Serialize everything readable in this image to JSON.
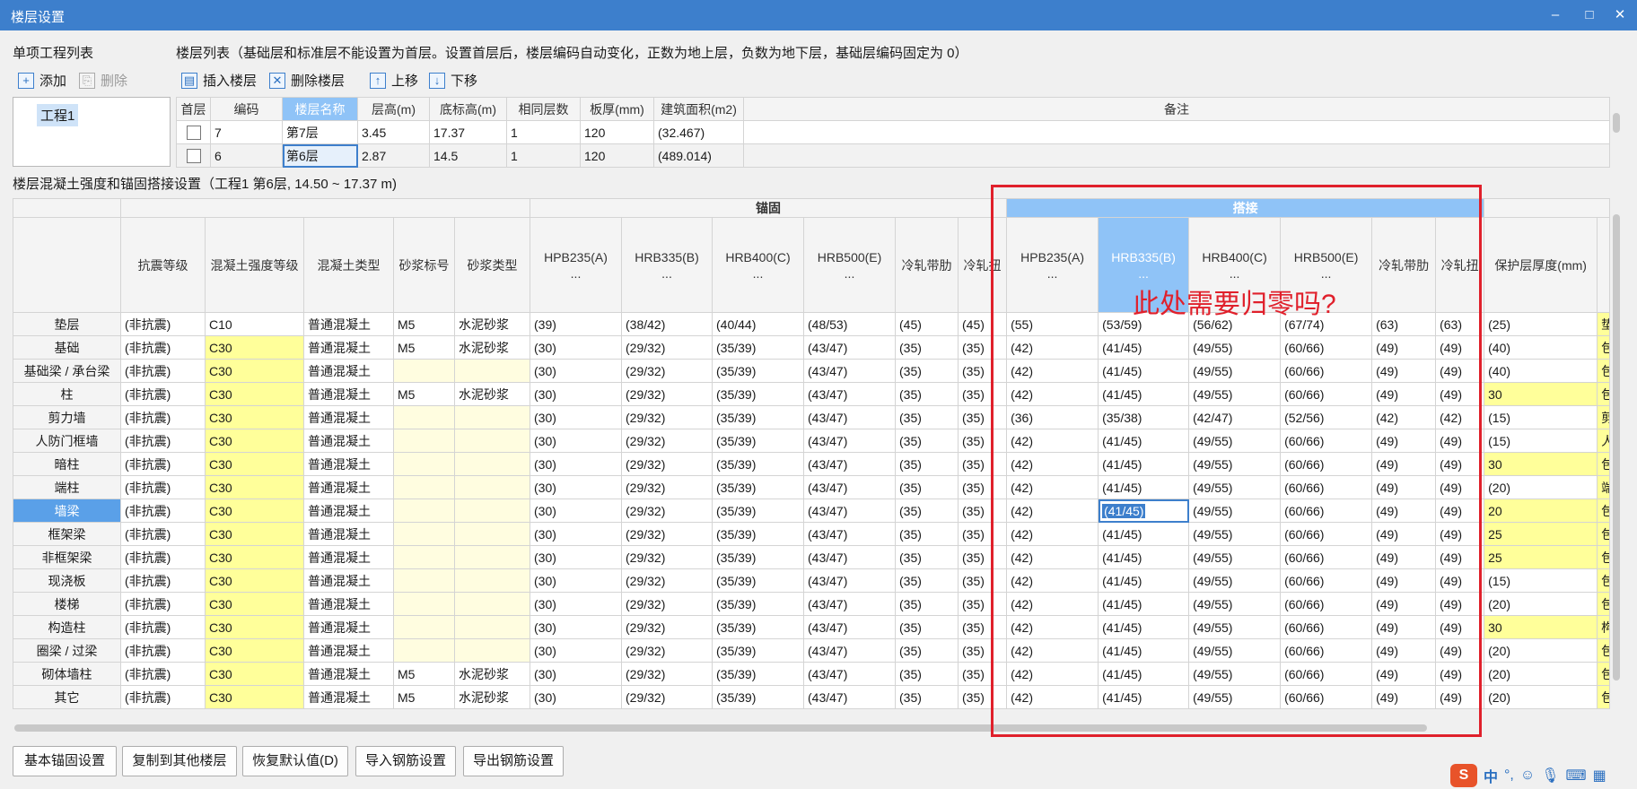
{
  "window": {
    "title": "楼层设置",
    "min": "–",
    "max": "□",
    "close": "✕"
  },
  "left": {
    "title": "单项工程列表",
    "add": "添加",
    "delete": "删除",
    "project": "工程1"
  },
  "floor": {
    "title": "楼层列表（基础层和标准层不能设置为首层。设置首层后，楼层编码自动变化，正数为地上层，负数为地下层，基础层编码固定为 0）",
    "insert": "插入楼层",
    "remove": "删除楼层",
    "up": "上移",
    "down": "下移",
    "headers": [
      "首层",
      "编码",
      "楼层名称",
      "层高(m)",
      "底标高(m)",
      "相同层数",
      "板厚(mm)",
      "建筑面积(m2)",
      "备注"
    ],
    "rows": [
      [
        "7",
        "第7层",
        "3.45",
        "17.37",
        "1",
        "120",
        "(32.467)"
      ],
      [
        "6",
        "第6层",
        "2.87",
        "14.5",
        "1",
        "120",
        "(489.014)"
      ]
    ]
  },
  "grid": {
    "title": "楼层混凝土强度和锚固搭接设置（工程1 第6层, 14.50 ~ 17.37 m)",
    "group_anchor": "锚固",
    "group_lap": "搭接",
    "headers": [
      "抗震等级",
      "混凝土强度等级",
      "混凝土类型",
      "砂浆标号",
      "砂浆类型"
    ],
    "sub_anchor": [
      "HPB235(A)",
      "HRB335(B)",
      "HRB400(C)",
      "HRB500(E)",
      "冷轧带肋",
      "冷轧扭"
    ],
    "sub_lap": [
      "HPB235(A)",
      "HRB335(B)",
      "HRB400(C)",
      "HRB500(E)",
      "冷轧带肋",
      "冷轧扭"
    ],
    "ellipsis": "...",
    "cover": "保护层厚度(mm)",
    "rows": [
      {
        "n": "垫层",
        "k": "(非抗震)",
        "c": "C10",
        "t": "普通混凝土",
        "m": "M5",
        "mt": "水泥砂浆",
        "a": [
          "(39)",
          "(38/42)",
          "(40/44)",
          "(48/53)",
          "(45)",
          "(45)"
        ],
        "l": [
          "(55)",
          "(53/59)",
          "(56/62)",
          "(67/74)",
          "(63)",
          "(63)"
        ],
        "p": "(25)",
        "r": "垫"
      },
      {
        "n": "基础",
        "k": "(非抗震)",
        "c": "C30",
        "t": "普通混凝土",
        "m": "M5",
        "mt": "水泥砂浆",
        "a": [
          "(30)",
          "(29/32)",
          "(35/39)",
          "(43/47)",
          "(35)",
          "(35)"
        ],
        "l": [
          "(42)",
          "(41/45)",
          "(49/55)",
          "(60/66)",
          "(49)",
          "(49)"
        ],
        "p": "(40)",
        "r": "包"
      },
      {
        "n": "基础梁 / 承台梁",
        "k": "(非抗震)",
        "c": "C30",
        "t": "普通混凝土",
        "m": "",
        "mt": "",
        "a": [
          "(30)",
          "(29/32)",
          "(35/39)",
          "(43/47)",
          "(35)",
          "(35)"
        ],
        "l": [
          "(42)",
          "(41/45)",
          "(49/55)",
          "(60/66)",
          "(49)",
          "(49)"
        ],
        "p": "(40)",
        "r": "包"
      },
      {
        "n": "柱",
        "k": "(非抗震)",
        "c": "C30",
        "t": "普通混凝土",
        "m": "M5",
        "mt": "水泥砂浆",
        "a": [
          "(30)",
          "(29/32)",
          "(35/39)",
          "(43/47)",
          "(35)",
          "(35)"
        ],
        "l": [
          "(42)",
          "(41/45)",
          "(49/55)",
          "(60/66)",
          "(49)",
          "(49)"
        ],
        "p": "30",
        "r": "包"
      },
      {
        "n": "剪力墙",
        "k": "(非抗震)",
        "c": "C30",
        "t": "普通混凝土",
        "m": "",
        "mt": "",
        "a": [
          "(30)",
          "(29/32)",
          "(35/39)",
          "(43/47)",
          "(35)",
          "(35)"
        ],
        "l": [
          "(36)",
          "(35/38)",
          "(42/47)",
          "(52/56)",
          "(42)",
          "(42)"
        ],
        "p": "(15)",
        "r": "剪"
      },
      {
        "n": "人防门框墙",
        "k": "(非抗震)",
        "c": "C30",
        "t": "普通混凝土",
        "m": "",
        "mt": "",
        "a": [
          "(30)",
          "(29/32)",
          "(35/39)",
          "(43/47)",
          "(35)",
          "(35)"
        ],
        "l": [
          "(42)",
          "(41/45)",
          "(49/55)",
          "(60/66)",
          "(49)",
          "(49)"
        ],
        "p": "(15)",
        "r": "人"
      },
      {
        "n": "暗柱",
        "k": "(非抗震)",
        "c": "C30",
        "t": "普通混凝土",
        "m": "",
        "mt": "",
        "a": [
          "(30)",
          "(29/32)",
          "(35/39)",
          "(43/47)",
          "(35)",
          "(35)"
        ],
        "l": [
          "(42)",
          "(41/45)",
          "(49/55)",
          "(60/66)",
          "(49)",
          "(49)"
        ],
        "p": "30",
        "r": "包"
      },
      {
        "n": "端柱",
        "k": "(非抗震)",
        "c": "C30",
        "t": "普通混凝土",
        "m": "",
        "mt": "",
        "a": [
          "(30)",
          "(29/32)",
          "(35/39)",
          "(43/47)",
          "(35)",
          "(35)"
        ],
        "l": [
          "(42)",
          "(41/45)",
          "(49/55)",
          "(60/66)",
          "(49)",
          "(49)"
        ],
        "p": "(20)",
        "r": "端"
      },
      {
        "n": "墙梁",
        "k": "(非抗震)",
        "c": "C30",
        "t": "普通混凝土",
        "m": "",
        "mt": "",
        "a": [
          "(30)",
          "(29/32)",
          "(35/39)",
          "(43/47)",
          "(35)",
          "(35)"
        ],
        "l": [
          "(42)",
          "(41/45)",
          "(49/55)",
          "(60/66)",
          "(49)",
          "(49)"
        ],
        "p": "20",
        "r": "包",
        "sel": true
      },
      {
        "n": "框架梁",
        "k": "(非抗震)",
        "c": "C30",
        "t": "普通混凝土",
        "m": "",
        "mt": "",
        "a": [
          "(30)",
          "(29/32)",
          "(35/39)",
          "(43/47)",
          "(35)",
          "(35)"
        ],
        "l": [
          "(42)",
          "(41/45)",
          "(49/55)",
          "(60/66)",
          "(49)",
          "(49)"
        ],
        "p": "25",
        "r": "包"
      },
      {
        "n": "非框架梁",
        "k": "(非抗震)",
        "c": "C30",
        "t": "普通混凝土",
        "m": "",
        "mt": "",
        "a": [
          "(30)",
          "(29/32)",
          "(35/39)",
          "(43/47)",
          "(35)",
          "(35)"
        ],
        "l": [
          "(42)",
          "(41/45)",
          "(49/55)",
          "(60/66)",
          "(49)",
          "(49)"
        ],
        "p": "25",
        "r": "包"
      },
      {
        "n": "现浇板",
        "k": "(非抗震)",
        "c": "C30",
        "t": "普通混凝土",
        "m": "",
        "mt": "",
        "a": [
          "(30)",
          "(29/32)",
          "(35/39)",
          "(43/47)",
          "(35)",
          "(35)"
        ],
        "l": [
          "(42)",
          "(41/45)",
          "(49/55)",
          "(60/66)",
          "(49)",
          "(49)"
        ],
        "p": "(15)",
        "r": "包"
      },
      {
        "n": "楼梯",
        "k": "(非抗震)",
        "c": "C30",
        "t": "普通混凝土",
        "m": "",
        "mt": "",
        "a": [
          "(30)",
          "(29/32)",
          "(35/39)",
          "(43/47)",
          "(35)",
          "(35)"
        ],
        "l": [
          "(42)",
          "(41/45)",
          "(49/55)",
          "(60/66)",
          "(49)",
          "(49)"
        ],
        "p": "(20)",
        "r": "包"
      },
      {
        "n": "构造柱",
        "k": "(非抗震)",
        "c": "C30",
        "t": "普通混凝土",
        "m": "",
        "mt": "",
        "a": [
          "(30)",
          "(29/32)",
          "(35/39)",
          "(43/47)",
          "(35)",
          "(35)"
        ],
        "l": [
          "(42)",
          "(41/45)",
          "(49/55)",
          "(60/66)",
          "(49)",
          "(49)"
        ],
        "p": "30",
        "r": "构"
      },
      {
        "n": "圈梁 / 过梁",
        "k": "(非抗震)",
        "c": "C30",
        "t": "普通混凝土",
        "m": "",
        "mt": "",
        "a": [
          "(30)",
          "(29/32)",
          "(35/39)",
          "(43/47)",
          "(35)",
          "(35)"
        ],
        "l": [
          "(42)",
          "(41/45)",
          "(49/55)",
          "(60/66)",
          "(49)",
          "(49)"
        ],
        "p": "(20)",
        "r": "包"
      },
      {
        "n": "砌体墙柱",
        "k": "(非抗震)",
        "c": "C30",
        "t": "普通混凝土",
        "m": "M5",
        "mt": "水泥砂浆",
        "a": [
          "(30)",
          "(29/32)",
          "(35/39)",
          "(43/47)",
          "(35)",
          "(35)"
        ],
        "l": [
          "(42)",
          "(41/45)",
          "(49/55)",
          "(60/66)",
          "(49)",
          "(49)"
        ],
        "p": "(20)",
        "r": "包"
      },
      {
        "n": "其它",
        "k": "(非抗震)",
        "c": "C30",
        "t": "普通混凝土",
        "m": "M5",
        "mt": "水泥砂浆",
        "a": [
          "(30)",
          "(29/32)",
          "(35/39)",
          "(43/47)",
          "(35)",
          "(35)"
        ],
        "l": [
          "(42)",
          "(41/45)",
          "(49/55)",
          "(60/66)",
          "(49)",
          "(49)"
        ],
        "p": "(20)",
        "r": "包"
      }
    ]
  },
  "annotation": "此处需要归零吗?",
  "buttons": {
    "b1": "基本锚固设置",
    "b2": "复制到其他楼层",
    "b3": "恢复默认值(D)",
    "b4": "导入钢筋设置",
    "b5": "导出钢筋设置"
  },
  "tray": {
    "logo": "S",
    "lang": "中"
  }
}
